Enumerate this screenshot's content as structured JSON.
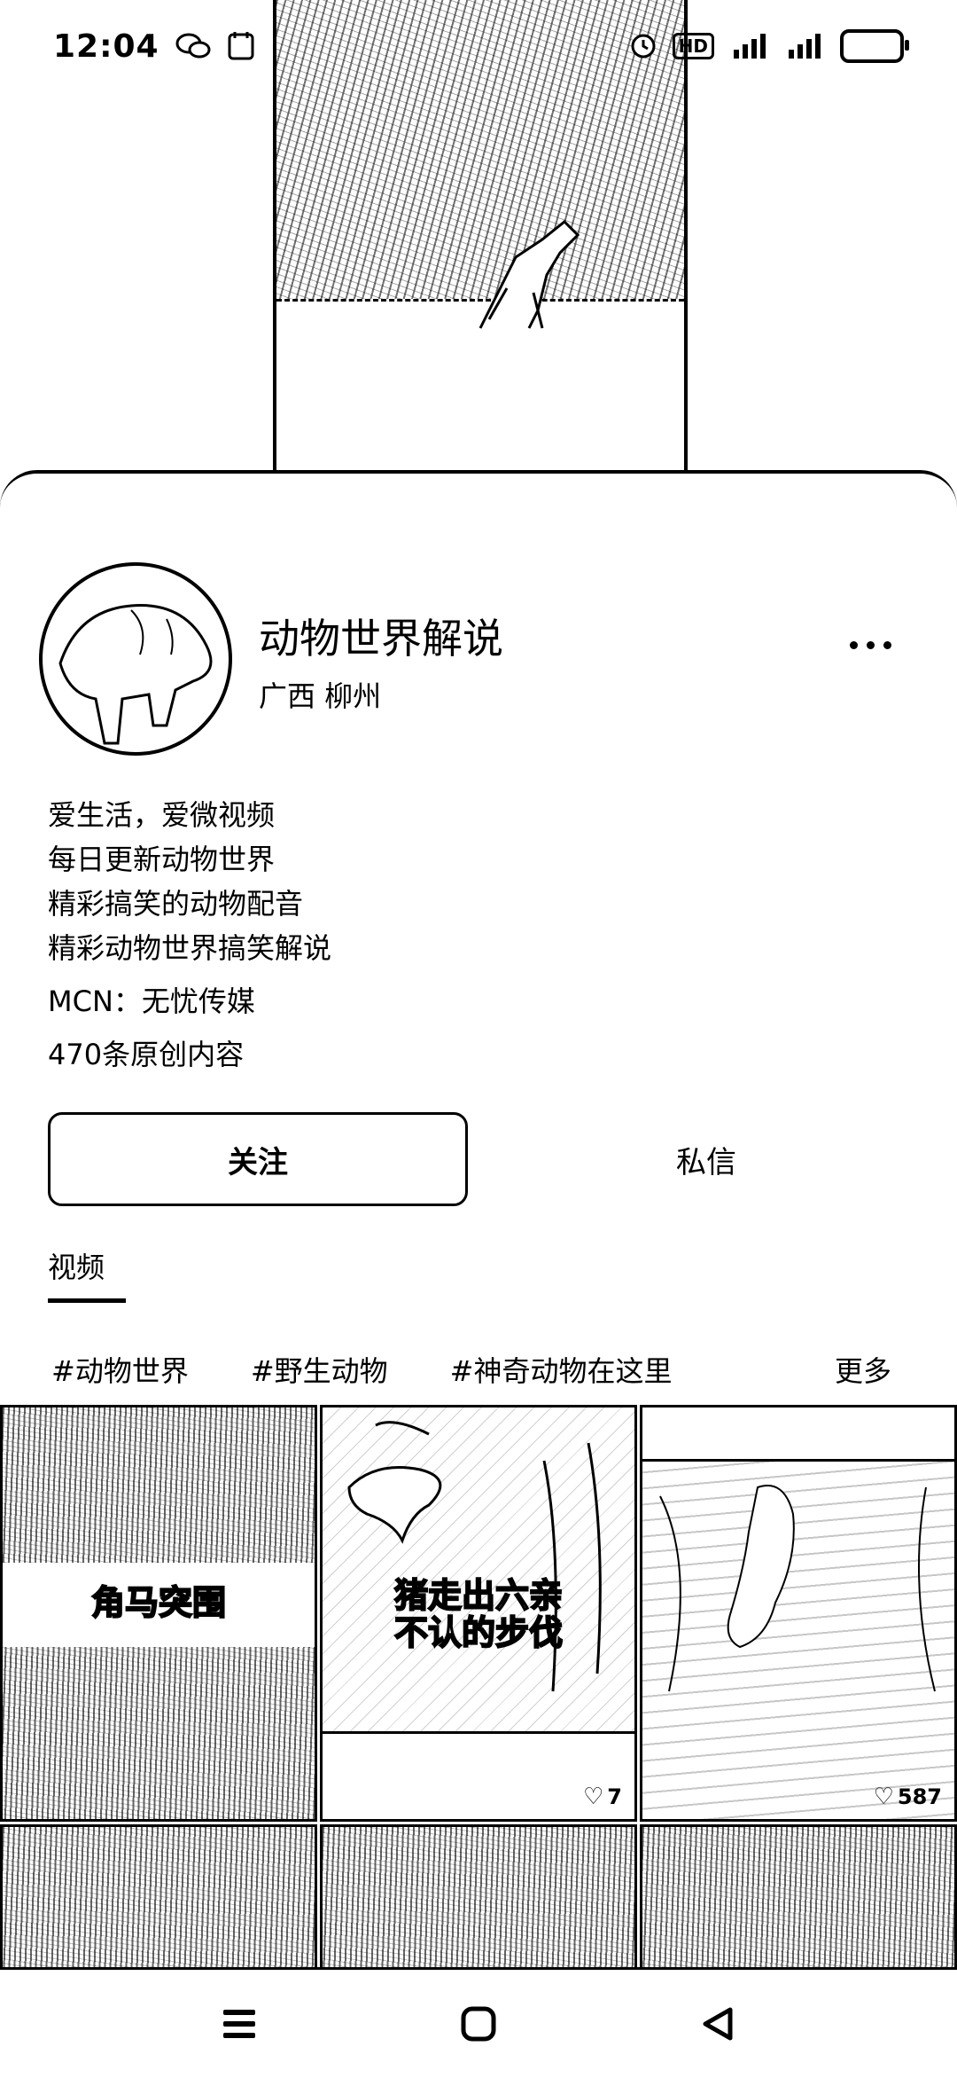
{
  "status_bar": {
    "time": "12:04",
    "icons": [
      "wechat-icon",
      "calendar-icon",
      "alarm-icon",
      "hd-icon",
      "signal-4g-icon",
      "signal-4g-icon",
      "battery-icon"
    ],
    "hd_label": "HD"
  },
  "profile": {
    "name": "动物世界解说",
    "location": "广西 柳州",
    "bio_lines": [
      "爱生活，爱微视频",
      "每日更新动物世界",
      "精彩搞笑的动物配音",
      "精彩动物世界搞笑解说"
    ],
    "mcn": "MCN：无忧传媒",
    "original_count": "470条原创内容"
  },
  "actions": {
    "follow_label": "关注",
    "message_label": "私信"
  },
  "tabs": {
    "video_label": "视频"
  },
  "hashtags": {
    "items": [
      "#动物世界",
      "#野生动物",
      "#神奇动物在这里"
    ],
    "more_label": "更多"
  },
  "videos": [
    {
      "caption": "角马突围",
      "likes": ""
    },
    {
      "caption_line1": "猪走出六亲",
      "caption_line2": "不认的步伐",
      "likes": "7"
    },
    {
      "caption": "",
      "likes": "587"
    },
    {
      "caption": "",
      "likes": ""
    },
    {
      "caption": "",
      "likes": ""
    },
    {
      "caption": "",
      "likes": ""
    }
  ],
  "nav": {
    "icons": [
      "menu-icon",
      "home-icon",
      "back-icon"
    ]
  }
}
